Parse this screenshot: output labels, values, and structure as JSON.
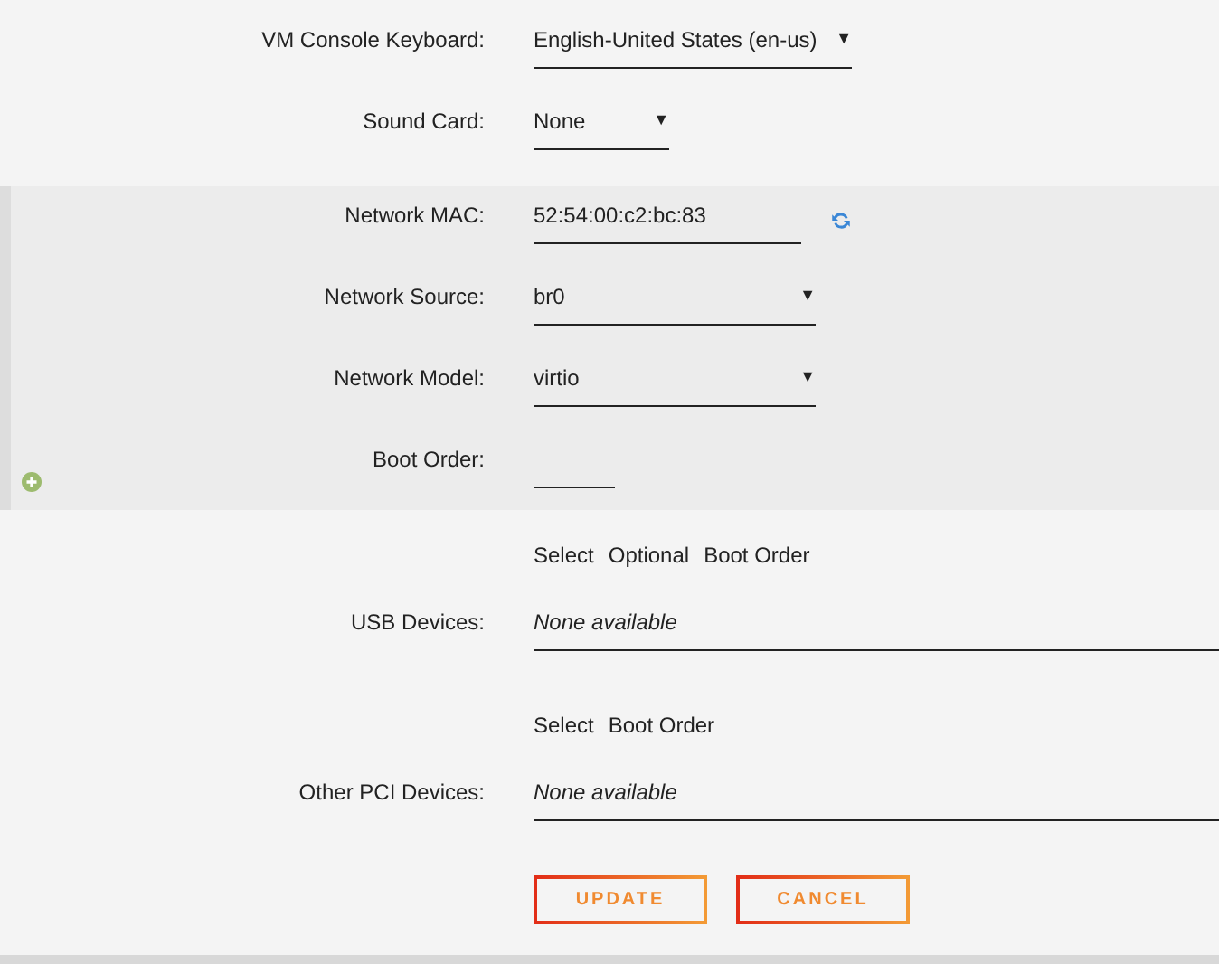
{
  "top_fields": [
    {
      "kind": "select",
      "label": "VM Console Keyboard:",
      "value": "English-United States (en-us)",
      "arrow": "▼"
    },
    {
      "kind": "select",
      "label": "Sound Card:",
      "value": "None",
      "arrow": "▼"
    }
  ],
  "network": {
    "fields": [
      {
        "kind": "mac",
        "label": "Network MAC:",
        "value": "52:54:00:c2:bc:83"
      },
      {
        "kind": "select",
        "label": "Network Source:",
        "value": "br0",
        "arrow": "▼"
      },
      {
        "kind": "select",
        "label": "Network Model:",
        "value": "virtio",
        "arrow": "▼"
      },
      {
        "kind": "input",
        "label": "Boot Order:"
      }
    ]
  },
  "devices": [
    {
      "headers": [
        "Select",
        "Optional",
        "Boot Order"
      ],
      "label": "USB Devices:",
      "value": "None available"
    },
    {
      "headers": [
        "Select",
        "Boot Order"
      ],
      "label": "Other PCI Devices:",
      "value": "None available"
    }
  ],
  "buttons": [
    "UPDATE",
    "CANCEL"
  ]
}
